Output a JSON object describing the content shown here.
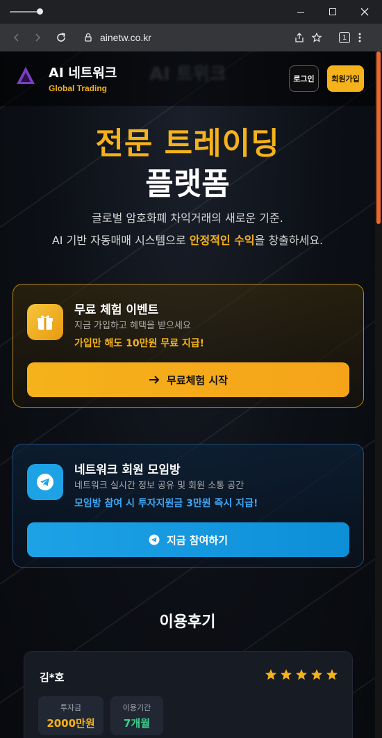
{
  "browser": {
    "url": "ainetw.co.kr",
    "tab_count": "1"
  },
  "header": {
    "brand": "AI 네트워크",
    "brand_sub": "Global Trading",
    "blur_text": "AI 트위크",
    "login_label": "로그인",
    "join_label": "회원가입"
  },
  "hero": {
    "title_line1": "전문 트레이딩",
    "title_line2": "플랫폼",
    "desc_line1": "글로벌 암호화폐 차익거래의 새로운 기준.",
    "desc_line2_pre": "AI 기반 자동매매 시스템으로 ",
    "desc_line2_hl": "안정적인 수익",
    "desc_line2_post": "을 창출하세요."
  },
  "event_card": {
    "title": "무료 체험 이벤트",
    "subtitle": "지금 가입하고 혜택을 받으세요",
    "highlight": "가입만 해도 10만원 무료 지급!",
    "button": "무료체험 시작",
    "icon": "gift-icon"
  },
  "telegram_card": {
    "title": "네트워크 회원 모임방",
    "subtitle": "네트워크 실시간 정보 공유 및 회원 소통 공간",
    "highlight": "모임방 참여 시 투자지원금 3만원 즉시 지급!",
    "button": "지금 참여하기",
    "icon": "telegram-icon"
  },
  "reviews": {
    "title": "이용후기",
    "items": [
      {
        "name": "김*호",
        "rating": 5,
        "invest_label": "투자금",
        "invest_value": "2000만원",
        "period_label": "이용기간",
        "period_value": "7개월"
      }
    ]
  },
  "colors": {
    "accent": "#f5b21a",
    "telegram": "#1ea2e6",
    "scroll_thumb": "#e8692b"
  }
}
